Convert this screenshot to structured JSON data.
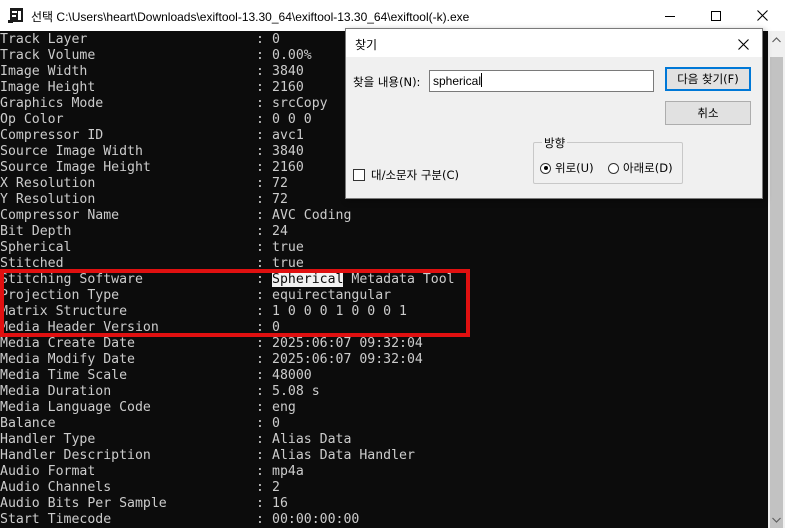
{
  "window": {
    "title": "선택 C:\\Users\\heart\\Downloads\\exiftool-13.30_64\\exiftool-13.30_64\\exiftool(-k).exe"
  },
  "console": {
    "highlight_color": "#e01010",
    "rows": [
      {
        "tag": "Track Layer",
        "value": "0"
      },
      {
        "tag": "Track Volume",
        "value": "0.00%"
      },
      {
        "tag": "Image Width",
        "value": "3840"
      },
      {
        "tag": "Image Height",
        "value": "2160"
      },
      {
        "tag": "Graphics Mode",
        "value": "srcCopy"
      },
      {
        "tag": "Op Color",
        "value": "0 0 0"
      },
      {
        "tag": "Compressor ID",
        "value": "avc1"
      },
      {
        "tag": "Source Image Width",
        "value": "3840"
      },
      {
        "tag": "Source Image Height",
        "value": "2160"
      },
      {
        "tag": "X Resolution",
        "value": "72"
      },
      {
        "tag": "Y Resolution",
        "value": "72"
      },
      {
        "tag": "Compressor Name",
        "value": "AVC Coding"
      },
      {
        "tag": "Bit Depth",
        "value": "24"
      },
      {
        "tag": "Spherical",
        "value": "true"
      },
      {
        "tag": "Stitched",
        "value": "true"
      },
      {
        "tag": "Stitching Software",
        "value_highlight": "Spherical",
        "value_rest": " Metadata Tool"
      },
      {
        "tag": "Projection Type",
        "value": "equirectangular"
      },
      {
        "tag": "Matrix Structure",
        "value": "1 0 0 0 1 0 0 0 1"
      },
      {
        "tag": "Media Header Version",
        "value": "0"
      },
      {
        "tag": "Media Create Date",
        "value": "2025:06:07 09:32:04"
      },
      {
        "tag": "Media Modify Date",
        "value": "2025:06:07 09:32:04"
      },
      {
        "tag": "Media Time Scale",
        "value": "48000"
      },
      {
        "tag": "Media Duration",
        "value": "5.08 s"
      },
      {
        "tag": "Media Language Code",
        "value": "eng"
      },
      {
        "tag": "Balance",
        "value": "0"
      },
      {
        "tag": "Handler Type",
        "value": "Alias Data"
      },
      {
        "tag": "Handler Description",
        "value": "Alias Data Handler"
      },
      {
        "tag": "Audio Format",
        "value": "mp4a"
      },
      {
        "tag": "Audio Channels",
        "value": "2"
      },
      {
        "tag": "Audio Bits Per Sample",
        "value": "16"
      },
      {
        "tag": "Start Timecode",
        "value": "00:00:00:00"
      }
    ]
  },
  "find_dialog": {
    "title": "찾기",
    "find_label": "찾을 내용(N):",
    "find_value": "spherical",
    "find_next_label": "다음 찾기(F)",
    "cancel_label": "취소",
    "match_case_label": "대/소문자 구분(C)",
    "match_case_checked": false,
    "direction_label": "방향",
    "up_label": "위로(U)",
    "down_label": "아래로(D)",
    "direction_selected": "up"
  }
}
